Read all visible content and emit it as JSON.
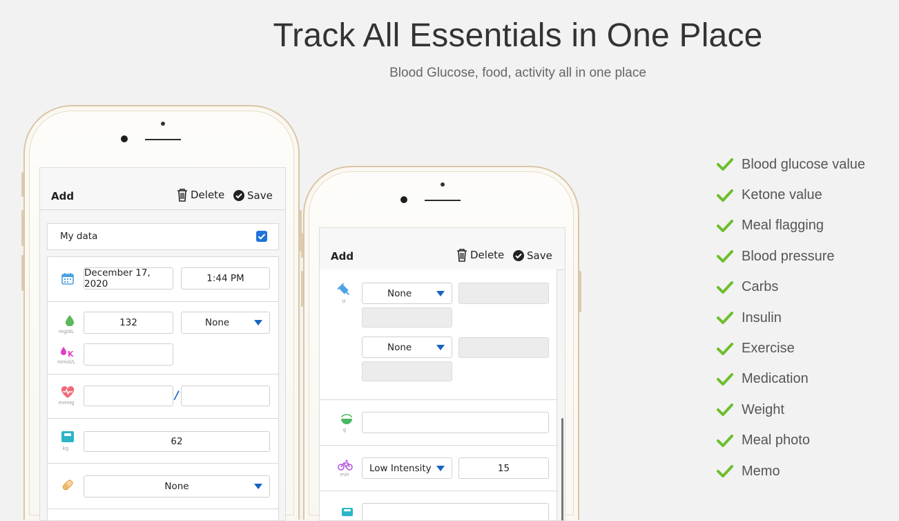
{
  "header": {
    "title": "Track All Essentials in One Place",
    "subtitle": "Blood Glucose, food, activity all in one place"
  },
  "features": [
    "Blood glucose value",
    "Ketone value",
    "Meal flagging",
    "Blood pressure",
    "Carbs",
    "Insulin",
    "Exercise",
    "Medication",
    "Weight",
    "Meal photo",
    "Memo"
  ],
  "colors": {
    "check": "#6cbf2c",
    "accent": "#1565c0",
    "phone_frame": "#d9c6a5"
  },
  "phone_left": {
    "toolbar": {
      "add": "Add",
      "delete": "Delete",
      "save": "Save"
    },
    "my_data": {
      "label": "My data",
      "checked": true
    },
    "date": "December 17, 2020",
    "time": "1:44 PM",
    "glucose": {
      "value": "132",
      "unit": "mg/dL",
      "flag": "None"
    },
    "ketone": {
      "value": "",
      "unit": "mmol/L",
      "icon_letter": "K"
    },
    "blood_pressure": {
      "systolic": "",
      "separator": "/",
      "diastolic": "",
      "unit": "mmHg"
    },
    "weight": {
      "value": "62",
      "unit": "kg"
    },
    "medication": {
      "value": "None"
    }
  },
  "phone_right": {
    "toolbar": {
      "add": "Add",
      "delete": "Delete",
      "save": "Save"
    },
    "insulin": {
      "unit": "U",
      "entries": [
        {
          "type": "None",
          "value": "",
          "note": ""
        },
        {
          "type": "None",
          "value": "",
          "note": ""
        }
      ]
    },
    "carbs": {
      "value": "",
      "unit": "g"
    },
    "exercise": {
      "intensity": "Low Intensity",
      "minutes": "15",
      "unit": "min"
    }
  }
}
